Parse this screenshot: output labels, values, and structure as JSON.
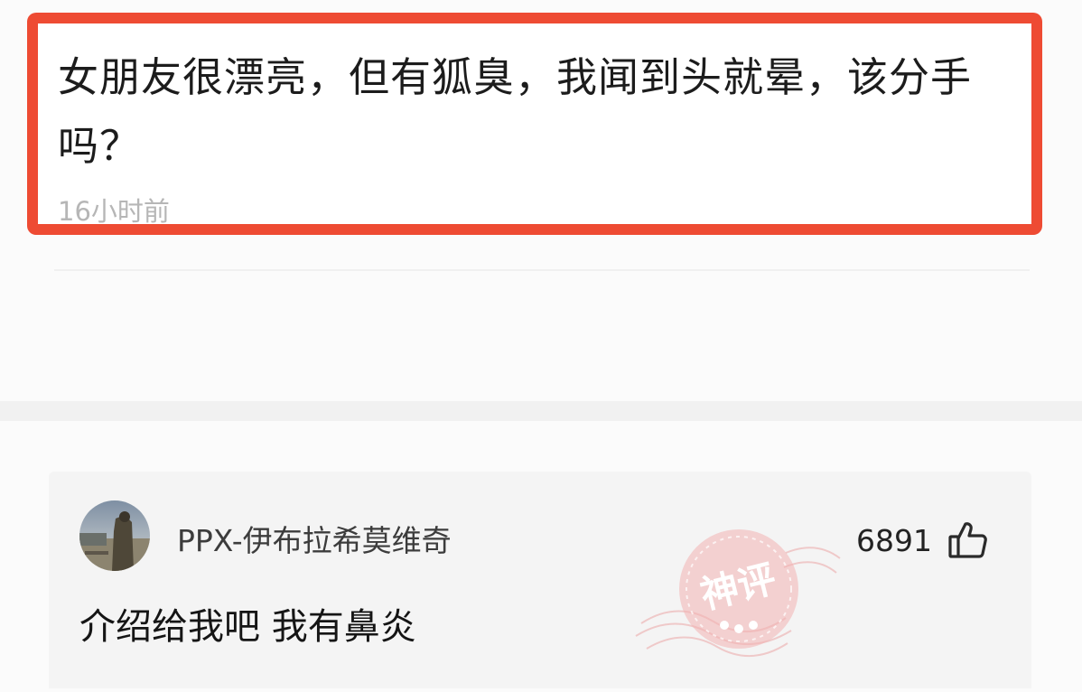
{
  "post": {
    "title": "女朋友很漂亮，但有狐臭，我闻到头就晕，该分手吗？",
    "time": "16小时前",
    "highlight_color": "#ee4b33"
  },
  "comment": {
    "username": "PPX-伊布拉希莫维奇",
    "likes": "6891",
    "like_icon": "thumbs-up-icon",
    "text": "介绍给我吧 我有鼻炎",
    "badge": {
      "icon": "god-comment-stamp",
      "text": "神评",
      "color": "#e8585a"
    }
  }
}
